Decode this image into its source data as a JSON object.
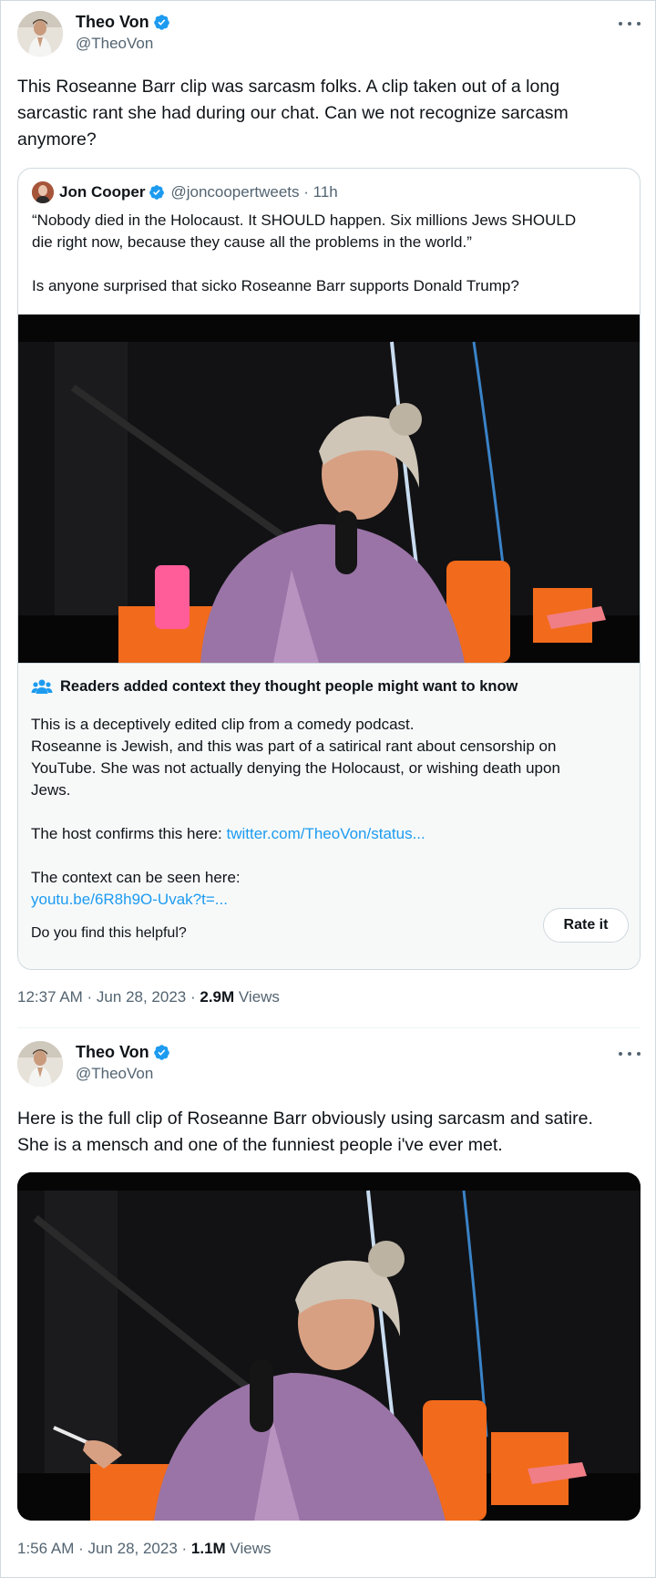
{
  "tweet1": {
    "display_name": "Theo Von",
    "handle": "@TheoVon",
    "text": "This Roseanne Barr clip was sarcasm folks.  A clip taken out of a long\nsarcastic rant she had during our chat.  Can we not recognize sarcasm\nanymore?",
    "quote": {
      "display_name": "Jon Cooper",
      "handle": "@joncoopertweets",
      "separator": " · ",
      "time": "11h",
      "text": "“Nobody died in the Holocaust. It SHOULD happen. Six millions Jews SHOULD\ndie right now, because they cause all the problems in the world.”\n\nIs anyone surprised that sicko Roseanne Barr supports Donald Trump?"
    },
    "context": {
      "title": "Readers added context they thought people might want to know",
      "body": "This is a deceptively edited clip from a comedy podcast.\nRoseanne is Jewish, and this was part of a satirical rant about censorship on\nYouTube. She was not actually denying the Holocaust, or wishing death upon\nJews.",
      "host_prefix": "The host confirms this here: ",
      "host_link": "twitter.com/TheoVon/status...",
      "context_prefix": "The context can be seen here:",
      "context_link": "youtu.be/6R8h9O-Uvak?t=...",
      "helpful_question": "Do you find this helpful?",
      "rate_label": "Rate it"
    },
    "time": "12:37 AM · Jun 28, 2023 · ",
    "views_count": "2.9M",
    "views_label": " Views"
  },
  "tweet2": {
    "display_name": "Theo Von",
    "handle": "@TheoVon",
    "text": "Here is the full clip of Roseanne Barr obviously using sarcasm and satire.\nShe is a mensch and one of the funniest people i've ever met.",
    "time": "1:56 AM · Jun 28, 2023 · ",
    "views_count": "1.1M",
    "views_label": " Views"
  },
  "icons": {
    "verified": "verified-badge-icon",
    "more": "more-dots-icon",
    "community_notes": "people-icon"
  },
  "colors": {
    "accent": "#1d9bf0",
    "text": "#0f1419",
    "secondary": "#536471",
    "chair": "#f26a1b",
    "shirt": "#9a74a6"
  }
}
